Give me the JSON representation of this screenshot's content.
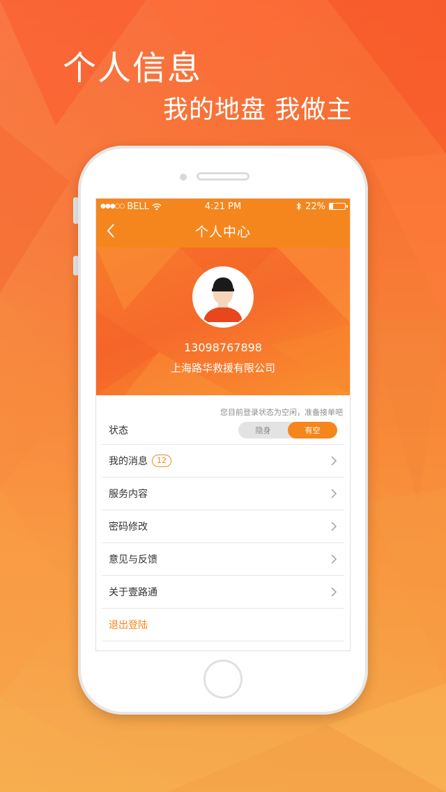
{
  "promo": {
    "title": "个人信息",
    "subtitle": "我的地盘  我做主"
  },
  "status_bar": {
    "signal": "●●●○○",
    "carrier": "BELL",
    "time": "4:21 PM",
    "battery_text": "22%",
    "battery_level": 0.22
  },
  "nav": {
    "title": "个人中心"
  },
  "profile": {
    "phone": "13098767898",
    "company": "上海路华救援有限公司"
  },
  "status_section": {
    "hint": "您目前登录状态为空闲，准备接单吧",
    "label": "状态",
    "options": [
      "隐身",
      "有空"
    ],
    "selected": "有空"
  },
  "menu": {
    "messages": {
      "label": "我的消息",
      "badge": "12"
    },
    "services": {
      "label": "服务内容"
    },
    "password": {
      "label": "密码修改"
    },
    "feedback": {
      "label": "意见与反馈"
    },
    "about": {
      "label": "关于壹路通"
    },
    "logout": {
      "label": "退出登陆"
    }
  },
  "colors": {
    "accent": "#f5861d",
    "background_top": "#f9652f",
    "background_bottom": "#f6a744"
  },
  "icons": [
    "back-chevron-icon",
    "wifi-icon",
    "bluetooth-icon",
    "battery-icon",
    "chevron-right-icon"
  ]
}
